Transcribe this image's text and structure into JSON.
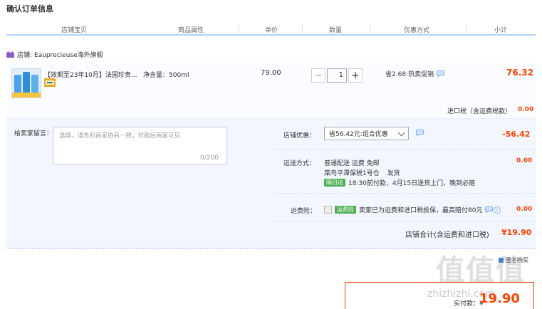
{
  "page": {
    "title": "确认订单信息"
  },
  "headers": [
    "店铺宝贝",
    "商品属性",
    "单价",
    "数量",
    "优惠方式",
    "小计"
  ],
  "shop": {
    "label": "店铺:",
    "name": "Eauprecieuse海外旗舰"
  },
  "item": {
    "title": "【效期至23年10月】法国珍贵...",
    "attr": "净含量：500ml",
    "price": "79.00",
    "qty": "1",
    "minus": "−",
    "plus": "+",
    "promo": "省2.68:热卖促销",
    "subtotal": "76.32"
  },
  "tax": {
    "label": "进口税（含运费税款）",
    "value": "0.00"
  },
  "memo": {
    "label": "给卖家留言：",
    "placeholder": "选填，请先和商家协商一致，付款后商家可见",
    "count": "0/200"
  },
  "discount": {
    "label": "店铺优惠：",
    "selected": "省56.42元:组合优惠",
    "value": "-56.42"
  },
  "shipping": {
    "label": "运送方式：",
    "method": "普通配送 运费 免邮",
    "from": "菜鸟平潭保税1号仓",
    "from_suffix": "发货",
    "tag": "隔日达",
    "eta": "18:30前付款，4月15日送货上门，晚到必赔",
    "value": "0.00"
  },
  "insurance": {
    "label": "运费险：",
    "tag": "运费险",
    "desc": "卖家已为运费和进口税投保，最高赔付80元",
    "value": "0.00"
  },
  "store_total": {
    "label": "店铺合计(含运费和进口税)",
    "value": "¥19.90"
  },
  "side_tag": "匿名购买",
  "pay": {
    "label": "实付款：",
    "symbol": "¥",
    "value": "19.90"
  },
  "watermark": {
    "text": "值值值",
    "url": "zhizhizhi.com"
  },
  "colors": {
    "accent": "#ff4400",
    "header_line": "#b2d1ff",
    "panel": "#f2f7ff"
  }
}
